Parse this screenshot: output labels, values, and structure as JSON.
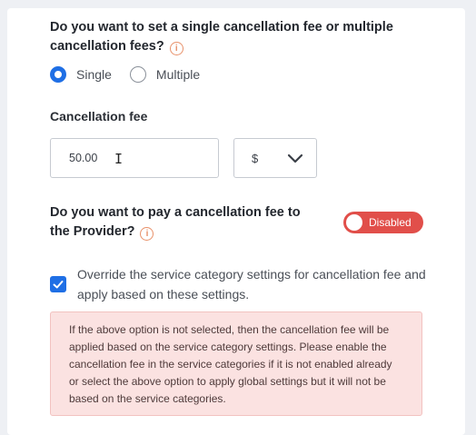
{
  "fee_mode": {
    "question": "Do you want to set a single cancellation fee or multiple cancellation fees?",
    "options": [
      {
        "label": "Single",
        "selected": true
      },
      {
        "label": "Multiple",
        "selected": false
      }
    ]
  },
  "cancellation_fee": {
    "label": "Cancellation fee",
    "value": "50.00",
    "currency": "$"
  },
  "provider_fee": {
    "question": "Do you want to pay a cancellation fee to the Provider?",
    "toggle_label": "Disabled",
    "toggle_color": "#e14f4a"
  },
  "override": {
    "checked": true,
    "label": "Override the service category settings for cancellation fee and apply based on these settings."
  },
  "notice": {
    "text": "If the above option is not selected, then the cancellation fee will be applied based on the service category settings. Please enable the cancellation fee in the service categories if it is not enabled already or select the above option to apply global settings but it will not be based on the service categories."
  },
  "colors": {
    "accent": "#1f6fe5",
    "info": "#e8916a",
    "notice_bg": "#fbe2e1"
  }
}
